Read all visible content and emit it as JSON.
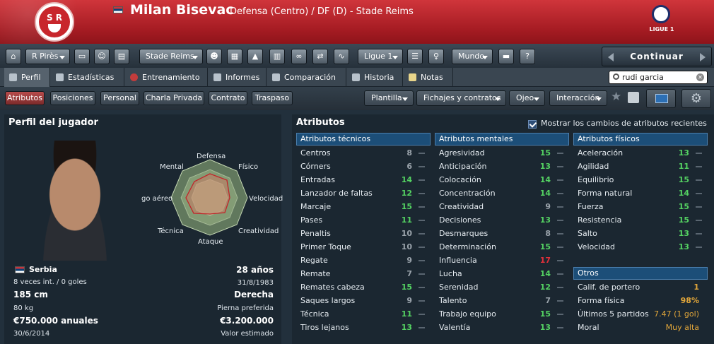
{
  "header": {
    "player_name": "Milan Bisevac",
    "player_info": "Defensa (Centro) / DF (D) - Stade Reims",
    "club_crest_text": "S R",
    "league_logo_text": "LIGUE 1"
  },
  "toolbar": {
    "manager_select": "R Pirès",
    "club_select": "Stade Reims",
    "league_select": "Ligue 1",
    "world_select": "Mundo",
    "help_label": "?",
    "continue_label": "Continuar"
  },
  "tabs": [
    {
      "label": "Perfil"
    },
    {
      "label": "Estadísticas"
    },
    {
      "label": "Entrenamiento"
    },
    {
      "label": "Informes"
    },
    {
      "label": "Comparación"
    },
    {
      "label": "Historia"
    },
    {
      "label": "Notas"
    }
  ],
  "search": {
    "value": "rudi garcia"
  },
  "subnav": {
    "buttons": [
      "Atributos",
      "Posiciones",
      "Personal",
      "Charla Privada",
      "Contrato",
      "Traspaso"
    ],
    "menus": [
      "Plantilla",
      "Fichajes y contratos",
      "Ojeo",
      "Interacción"
    ]
  },
  "profile": {
    "title": "Perfil del jugador",
    "radar_labels": {
      "defensa": "Defensa",
      "fisico": "Físico",
      "velocidad": "Velocidad",
      "creatividad": "Creatividad",
      "ataque": "Ataque",
      "tecnica": "Técnica",
      "juego_aereo": "go aéreo",
      "mental": "Mental"
    },
    "nationality": "Serbia",
    "caps": "8 veces int. / 0 goles",
    "age": "28 años",
    "dob": "31/8/1983",
    "height": "185 cm",
    "foot": "Derecha",
    "weight": "80 kg",
    "foot_label": "Pierna preferida",
    "wage": "€750.000 anuales",
    "value": "€3.200.000",
    "contract_end": "30/6/2014",
    "value_label": "Valor estimado"
  },
  "attributes": {
    "title": "Atributos",
    "show_changes_label": "Mostrar los cambios de atributos recientes",
    "show_changes_checked": true,
    "technical": {
      "header": "Atributos técnicos",
      "rows": [
        {
          "name": "Centros",
          "value": "8"
        },
        {
          "name": "Córners",
          "value": "6"
        },
        {
          "name": "Entradas",
          "value": "14"
        },
        {
          "name": "Lanzador de faltas",
          "value": "12"
        },
        {
          "name": "Marcaje",
          "value": "15"
        },
        {
          "name": "Pases",
          "value": "11"
        },
        {
          "name": "Penaltis",
          "value": "10"
        },
        {
          "name": "Primer Toque",
          "value": "10"
        },
        {
          "name": "Regate",
          "value": "9"
        },
        {
          "name": "Remate",
          "value": "7"
        },
        {
          "name": "Remates cabeza",
          "value": "15"
        },
        {
          "name": "Saques largos",
          "value": "9"
        },
        {
          "name": "Técnica",
          "value": "11"
        },
        {
          "name": "Tiros lejanos",
          "value": "13"
        }
      ]
    },
    "mental": {
      "header": "Atributos mentales",
      "rows": [
        {
          "name": "Agresividad",
          "value": "15"
        },
        {
          "name": "Anticipación",
          "value": "13"
        },
        {
          "name": "Colocación",
          "value": "14"
        },
        {
          "name": "Concentración",
          "value": "14"
        },
        {
          "name": "Creatividad",
          "value": "9"
        },
        {
          "name": "Decisiones",
          "value": "13"
        },
        {
          "name": "Desmarques",
          "value": "8"
        },
        {
          "name": "Determinación",
          "value": "15"
        },
        {
          "name": "Influencia",
          "value": "17"
        },
        {
          "name": "Lucha",
          "value": "14"
        },
        {
          "name": "Serenidad",
          "value": "12"
        },
        {
          "name": "Talento",
          "value": "7"
        },
        {
          "name": "Trabajo equipo",
          "value": "15"
        },
        {
          "name": "Valentía",
          "value": "13"
        }
      ]
    },
    "physical": {
      "header": "Atributos físicos",
      "rows": [
        {
          "name": "Aceleración",
          "value": "13"
        },
        {
          "name": "Agilidad",
          "value": "11"
        },
        {
          "name": "Equilibrio",
          "value": "15"
        },
        {
          "name": "Forma natural",
          "value": "14"
        },
        {
          "name": "Fuerza",
          "value": "15"
        },
        {
          "name": "Resistencia",
          "value": "15"
        },
        {
          "name": "Salto",
          "value": "13"
        },
        {
          "name": "Velocidad",
          "value": "13"
        }
      ]
    },
    "other": {
      "header": "Otros",
      "rows": [
        {
          "name": "Calif. de portero",
          "value": "1"
        },
        {
          "name": "Forma física",
          "value": "98%"
        },
        {
          "name": "Últimos 5 partidos",
          "value": "7.47 (1 gol)"
        },
        {
          "name": "Moral",
          "value": "Muy alta"
        }
      ]
    }
  },
  "colors": {
    "good": "#54d262",
    "average": "#9aa3ab",
    "excellent": "#e0303a",
    "highlight": "#e1a63a",
    "header_red": "#b8242a"
  }
}
